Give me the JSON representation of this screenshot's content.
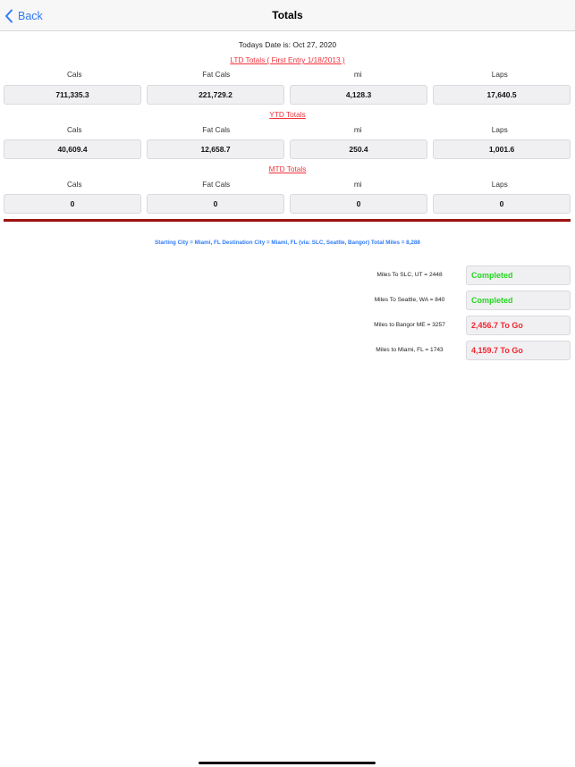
{
  "nav": {
    "back_label": "Back",
    "title": "Totals"
  },
  "date_line": "Todays Date is: Oct 27, 2020",
  "column_labels": [
    "Cals",
    "Fat Cals",
    "mi",
    "Laps"
  ],
  "sections": [
    {
      "title": "LTD Totals ( First Entry 1/18/2013 )",
      "values": [
        "711,335.3",
        "221,729.2",
        "4,128.3",
        "17,640.5"
      ]
    },
    {
      "title": "YTD Totals",
      "values": [
        "40,609.4",
        "12,658.7",
        "250.4",
        "1,001.6"
      ]
    },
    {
      "title": "MTD Totals",
      "values": [
        "0",
        "0",
        "0",
        "0"
      ]
    }
  ],
  "colors": {
    "accent_blue": "#2f7cf6",
    "section_red": "#f0313a",
    "divider": "#9b1210",
    "completed_green": "#22d81e",
    "togo_red": "#f0262e"
  },
  "trip_summary": "Starting City = Miami, FL Destination City = Miami, FL  (via: SLC, Seattle, Bangor) Total Miles = 8,288",
  "legs": [
    {
      "label": "Miles To SLC, UT = 2448",
      "status": "Completed",
      "state": "done"
    },
    {
      "label": "Miles To Seattle, WA = 840",
      "status": "Completed",
      "state": "done"
    },
    {
      "label": "Miles to Bangor ME = 3257",
      "status": "2,456.7 To Go",
      "state": "togo"
    },
    {
      "label": "Miles to Miami, FL = 1743",
      "status": "4,159.7 To Go",
      "state": "togo"
    }
  ]
}
